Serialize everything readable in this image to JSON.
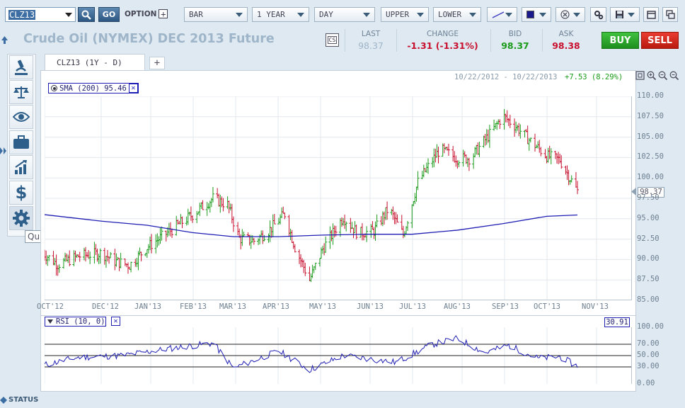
{
  "toolbar": {
    "symbol_value": "CLZ13",
    "go_label": "GO",
    "option_label": "OPTION",
    "chart_type": "BAR",
    "range": "1 YEAR",
    "interval": "DAY",
    "upper": "UPPER",
    "lower": "LOWER"
  },
  "title": "Crude Oil (NYMEX) DEC 2013 Future",
  "quote": {
    "last_label": "LAST",
    "last_value": "98.37",
    "change_label": "CHANGE",
    "change_value": "-1.31 (-1.31%)",
    "bid_label": "BID",
    "bid_value": "98.37",
    "ask_label": "ASK",
    "ask_value": "98.38",
    "buy_label": "BUY",
    "sell_label": "SELL",
    "cs_label": "CS"
  },
  "tab": {
    "label": "CLZ13 (1Y - D)",
    "add_label": "+"
  },
  "range_info": {
    "dates": "10/22/2012 - 10/22/2013",
    "change": "+7.53 (8.29%)"
  },
  "sma_legend": "SMA (200) 95.46",
  "rsi_legend": "RSI (10, 0)",
  "rsi_value": "30.91",
  "price_tag": "98.37",
  "tooltip": "Quick Settings",
  "status_label": "STATUS",
  "colors": {
    "up": "#1a9b1a",
    "down": "#c8102e",
    "sma": "#1e1eb4",
    "rsi": "#1e1eb4",
    "buy": "#2ca02c",
    "sell": "#d62a20"
  },
  "sidebar_icons": [
    "microscope-icon",
    "balance-scale-icon",
    "eye-icon",
    "briefcase-icon",
    "bar-chart-icon",
    "dollar-icon",
    "gear-icon"
  ],
  "chart_data": [
    {
      "type": "ohlc",
      "title": "CLZ13 (1Y - D)",
      "categories": [
        "OCT'12",
        "DEC'12",
        "JAN'13",
        "FEB'13",
        "MAR'13",
        "APR'13",
        "MAY'13",
        "JUN'13",
        "JUL'13",
        "AUG'13",
        "SEP'13",
        "OCT'13",
        "NOV'13"
      ],
      "y_ticks": [
        "110.00",
        "107.50",
        "105.00",
        "102.50",
        "100.00",
        "97.50",
        "95.00",
        "92.50",
        "90.00",
        "87.50",
        "85.00"
      ],
      "ylim": [
        85,
        110
      ],
      "grid": true,
      "close_path": [
        {
          "x": "2012-10-22",
          "y": 90.8
        },
        {
          "x": "2012-11-01",
          "y": 89.4
        },
        {
          "x": "2012-11-15",
          "y": 90.4
        },
        {
          "x": "2012-12-01",
          "y": 90.8
        },
        {
          "x": "2012-12-10",
          "y": 89.8
        },
        {
          "x": "2012-12-20",
          "y": 89.3
        },
        {
          "x": "2013-01-01",
          "y": 91.5
        },
        {
          "x": "2013-01-15",
          "y": 93.3
        },
        {
          "x": "2013-02-01",
          "y": 95.5
        },
        {
          "x": "2013-02-15",
          "y": 97.5
        },
        {
          "x": "2013-02-25",
          "y": 96.7
        },
        {
          "x": "2013-03-05",
          "y": 92.6
        },
        {
          "x": "2013-03-15",
          "y": 92.3
        },
        {
          "x": "2013-03-25",
          "y": 93.5
        },
        {
          "x": "2013-04-05",
          "y": 95.6
        },
        {
          "x": "2013-04-12",
          "y": 91.5
        },
        {
          "x": "2013-04-22",
          "y": 87.5
        },
        {
          "x": "2013-05-01",
          "y": 91.3
        },
        {
          "x": "2013-05-15",
          "y": 95.2
        },
        {
          "x": "2013-05-25",
          "y": 93.2
        },
        {
          "x": "2013-06-05",
          "y": 93.5
        },
        {
          "x": "2013-06-15",
          "y": 96.3
        },
        {
          "x": "2013-06-25",
          "y": 93.0
        },
        {
          "x": "2013-07-05",
          "y": 99.5
        },
        {
          "x": "2013-07-20",
          "y": 103.5
        },
        {
          "x": "2013-08-01",
          "y": 102.4
        },
        {
          "x": "2013-08-10",
          "y": 102.4
        },
        {
          "x": "2013-08-25",
          "y": 105.8
        },
        {
          "x": "2013-09-01",
          "y": 107.6
        },
        {
          "x": "2013-09-10",
          "y": 106.3
        },
        {
          "x": "2013-09-20",
          "y": 104.5
        },
        {
          "x": "2013-10-01",
          "y": 102.7
        },
        {
          "x": "2013-10-10",
          "y": 102.2
        },
        {
          "x": "2013-10-22",
          "y": 98.37
        }
      ],
      "series": [
        {
          "name": "SMA (200)",
          "last": 95.46,
          "values": [
            {
              "x": "2012-10-22",
              "y": 95.5
            },
            {
              "x": "2012-12-01",
              "y": 94.7
            },
            {
              "x": "2013-01-01",
              "y": 94.2
            },
            {
              "x": "2013-02-01",
              "y": 93.3
            },
            {
              "x": "2013-03-01",
              "y": 92.8
            },
            {
              "x": "2013-04-01",
              "y": 92.8
            },
            {
              "x": "2013-05-01",
              "y": 93.0
            },
            {
              "x": "2013-06-01",
              "y": 93.1
            },
            {
              "x": "2013-07-01",
              "y": 93.1
            },
            {
              "x": "2013-08-01",
              "y": 93.6
            },
            {
              "x": "2013-09-01",
              "y": 94.4
            },
            {
              "x": "2013-10-01",
              "y": 95.3
            },
            {
              "x": "2013-10-22",
              "y": 95.46
            }
          ]
        }
      ],
      "price_marker": 98.37
    },
    {
      "type": "line",
      "title": "RSI (10, 0)",
      "y_ticks": [
        "100.00",
        "70.00",
        "50.00",
        "30.00",
        "0.00"
      ],
      "ylim": [
        0,
        100
      ],
      "reference_lines": [
        70,
        50,
        30
      ],
      "series": [
        {
          "name": "RSI (10, 0)",
          "last": 30.91,
          "values": [
            {
              "x": "2012-10-22",
              "y": 33
            },
            {
              "x": "2012-11-15",
              "y": 47
            },
            {
              "x": "2012-12-15",
              "y": 50
            },
            {
              "x": "2013-01-15",
              "y": 62
            },
            {
              "x": "2013-02-15",
              "y": 72
            },
            {
              "x": "2013-03-01",
              "y": 28
            },
            {
              "x": "2013-04-01",
              "y": 58
            },
            {
              "x": "2013-04-22",
              "y": 25
            },
            {
              "x": "2013-05-15",
              "y": 50
            },
            {
              "x": "2013-06-20",
              "y": 38
            },
            {
              "x": "2013-07-15",
              "y": 70
            },
            {
              "x": "2013-08-01",
              "y": 80
            },
            {
              "x": "2013-08-20",
              "y": 55
            },
            {
              "x": "2013-09-05",
              "y": 68
            },
            {
              "x": "2013-09-25",
              "y": 45
            },
            {
              "x": "2013-10-10",
              "y": 48
            },
            {
              "x": "2013-10-22",
              "y": 30.91
            }
          ]
        }
      ]
    }
  ]
}
